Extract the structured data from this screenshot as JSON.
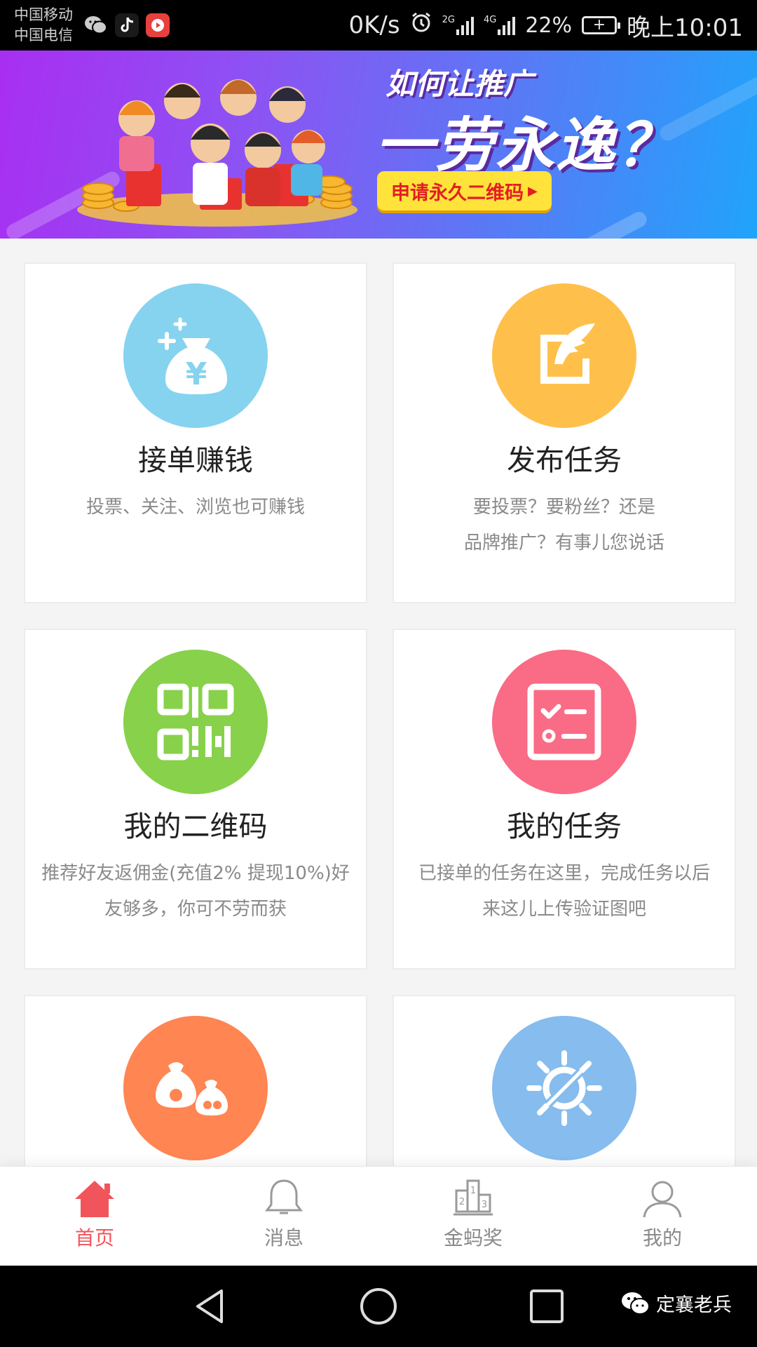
{
  "status_bar": {
    "carrier_1": "中国移动",
    "carrier_2": "中国电信",
    "net_speed": "0K/s",
    "net_2g": "2G",
    "net_4g": "4G",
    "battery": "22%",
    "time": "晚上10:01"
  },
  "banner": {
    "subtitle": "如何让推广",
    "title": "一劳永逸？",
    "button": "申请永久二维码"
  },
  "cards": [
    {
      "title": "接单赚钱",
      "desc": [
        "投票、关注、浏览也可赚钱"
      ],
      "color": "#86d3ef",
      "icon": "money-bag-icon"
    },
    {
      "title": "发布任务",
      "desc": [
        "要投票？要粉丝？还是",
        "品牌推广？有事儿您说话"
      ],
      "color": "#ffc04b",
      "icon": "feather-pen-icon"
    },
    {
      "title": "我的二维码",
      "desc": [
        "推荐好友返佣金(充值2% 提现10%)好",
        "友够多，你可不劳而获"
      ],
      "color": "#87d14b",
      "icon": "qr-code-icon"
    },
    {
      "title": "我的任务",
      "desc": [
        "已接单的任务在这里，完成任务以后",
        "来这儿上传验证图吧"
      ],
      "color": "#fa6b85",
      "icon": "task-checklist-icon"
    },
    {
      "title": "",
      "desc": [],
      "color": "#ff8552",
      "icon": "money-bags-icon"
    },
    {
      "title": "",
      "desc": [],
      "color": "#86bcee",
      "icon": "sun-compass-icon"
    }
  ],
  "tabbar": [
    {
      "label": "首页",
      "icon": "home-icon",
      "active": true
    },
    {
      "label": "消息",
      "icon": "bell-icon",
      "active": false
    },
    {
      "label": "金蚂奖",
      "icon": "podium-icon",
      "active": false
    },
    {
      "label": "我的",
      "icon": "user-icon",
      "active": false
    }
  ],
  "nav": {
    "watermark": "定襄老兵"
  },
  "colors": {
    "accent": "#f2545b",
    "tab_inactive": "#8a8a8a",
    "banner_btn": "#ffe33a"
  }
}
